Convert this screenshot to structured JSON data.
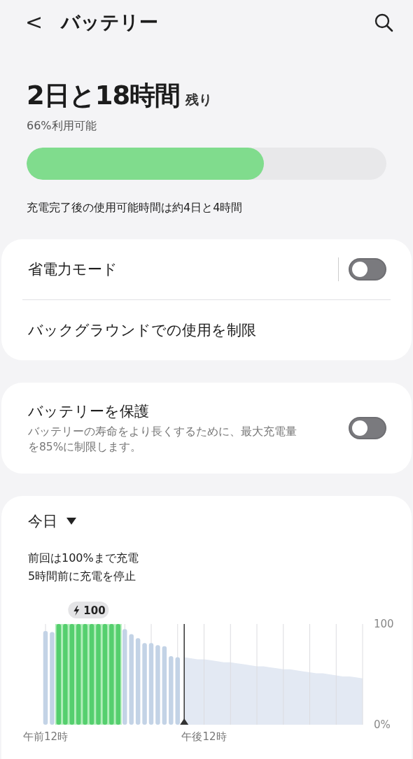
{
  "header": {
    "back": "<",
    "title": "バッテリー"
  },
  "summary": {
    "remaining": "2日と18時間",
    "remaining_suffix": "残り",
    "available": "66%利用可能",
    "level": 0.66,
    "full_charge": "充電完了後の使用可能時間は約4日と4時間"
  },
  "cards": [
    {
      "rows": [
        {
          "kind": "toggle",
          "label": "省電力モード",
          "on": false,
          "divider": true
        },
        {
          "kind": "link",
          "label": "バックグラウンドでの使用を制限"
        }
      ]
    },
    {
      "rows": [
        {
          "kind": "toggle",
          "label": "バッテリーを保護",
          "description": "バッテリーの寿命をより長くするために、最大充電量を85%に制限します。",
          "on": false
        }
      ]
    }
  ],
  "usage": {
    "period": "今日",
    "note_lines": [
      "前回は100%まで充電",
      "5時間前に充電を停止"
    ],
    "chart_data": {
      "type": "bar",
      "categories": [
        "午前12時",
        null,
        null,
        null,
        null,
        null,
        null,
        null,
        null,
        null,
        null,
        null,
        null,
        null,
        null,
        null,
        null,
        null,
        null,
        null,
        null,
        null,
        null,
        null,
        "午後12時",
        null,
        null,
        null,
        null,
        null,
        null,
        null,
        null,
        null,
        null,
        null,
        null,
        null,
        null,
        null,
        null,
        null,
        null,
        null,
        null,
        null,
        null,
        null,
        null
      ],
      "series": [
        {
          "type": "bar",
          "color": "#c3d3e6",
          "values": [
            93,
            92,
            null,
            null,
            null,
            null,
            null,
            null,
            null,
            null,
            null,
            null,
            95,
            90,
            86,
            81,
            81,
            79,
            78,
            68,
            67,
            null,
            null,
            null,
            null,
            null,
            null,
            null,
            null,
            null,
            null,
            null,
            null,
            null,
            null,
            null,
            null,
            null,
            null,
            null,
            null,
            null,
            null,
            null,
            null,
            null,
            null,
            null,
            null
          ]
        },
        {
          "type": "bar",
          "color": "#55cf6e",
          "values": [
            null,
            null,
            100,
            100,
            100,
            100,
            100,
            100,
            100,
            100,
            100,
            100,
            null,
            null,
            null,
            null,
            null,
            null,
            null,
            null,
            null,
            null,
            null,
            null,
            null,
            null,
            null,
            null,
            null,
            null,
            null,
            null,
            null,
            null,
            null,
            null,
            null,
            null,
            null,
            null,
            null,
            null,
            null,
            null,
            null,
            null,
            null,
            null,
            null
          ]
        },
        {
          "type": "area",
          "color": "#e3e9f3",
          "values": [
            null,
            null,
            null,
            null,
            null,
            null,
            null,
            null,
            null,
            null,
            null,
            null,
            null,
            null,
            null,
            null,
            null,
            null,
            null,
            null,
            null,
            67,
            66,
            65,
            65,
            64,
            63,
            62,
            62,
            61,
            60,
            59,
            58,
            58,
            57,
            56,
            55,
            55,
            54,
            53,
            52,
            51,
            51,
            50,
            49,
            48,
            48,
            47,
            46
          ]
        }
      ],
      "ylim": [
        0,
        100
      ],
      "grid": true,
      "yticks": [
        {
          "value": 100,
          "label": "100"
        },
        {
          "value": 0,
          "label": "0%"
        }
      ],
      "annotations": [
        "100"
      ]
    }
  }
}
